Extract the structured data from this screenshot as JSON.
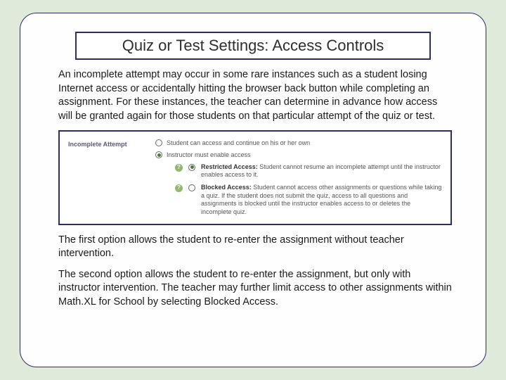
{
  "title": "Quiz or Test Settings: Access Controls",
  "para1": "An incomplete attempt may occur in some rare instances such as a student losing Internet access or accidentally hitting the browser back button while completing an assignment.  For these instances, the teacher can determine in advance how access will be granted again for those students on that particular attempt of the quiz or test.",
  "setting": {
    "label": "Incomplete Attempt",
    "opt1": "Student can access and continue on his or her own",
    "opt2": "Instructor must enable access",
    "sub1_bold": "Restricted Access:",
    "sub1_rest": " Student cannot resume an incomplete attempt until the instructor enables access to it.",
    "sub2_bold": "Blocked Access:",
    "sub2_rest": " Student cannot access other assignments or questions while taking a quiz. If the student does not submit the quiz, access to all questions and assignments is blocked until the instructor enables access to or deletes the incomplete quiz."
  },
  "para2": "The first option allows the student to re-enter the assignment without teacher intervention.",
  "para3": "The second option allows the student to re-enter the assignment, but only with instructor intervention. The teacher may further limit access to other assignments within Math.XL for School by selecting Blocked Access."
}
